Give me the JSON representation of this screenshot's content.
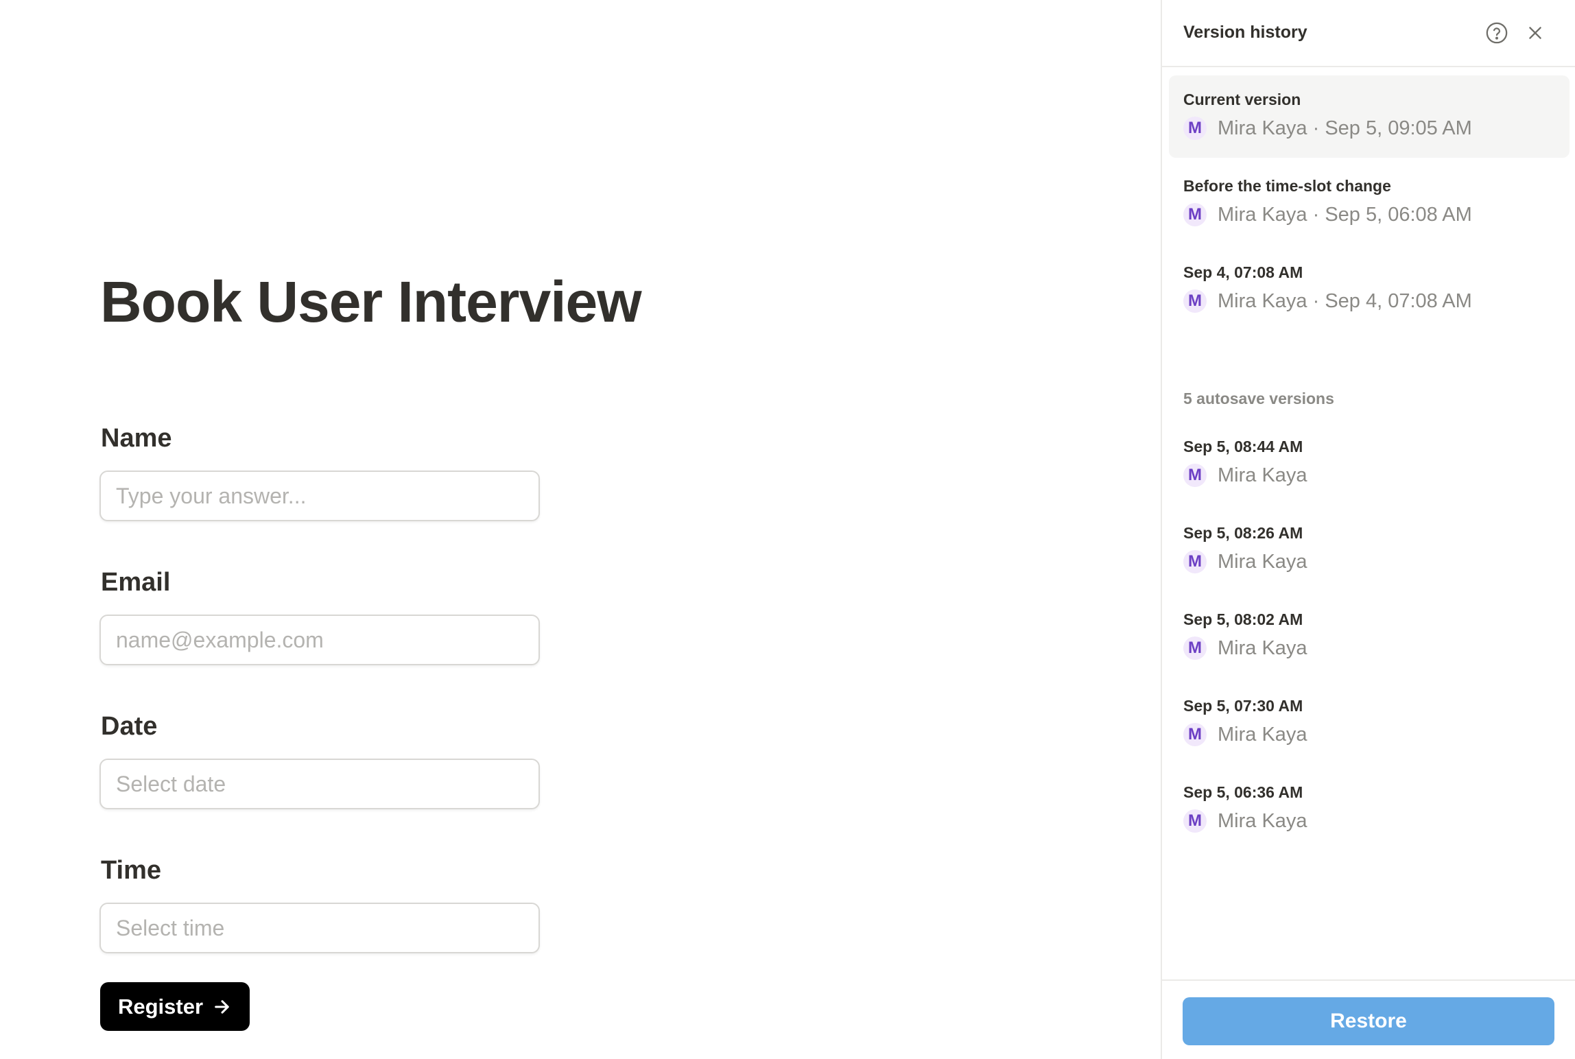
{
  "form": {
    "title": "Book User Interview",
    "fields": [
      {
        "label": "Name",
        "placeholder": "Type your answer..."
      },
      {
        "label": "Email",
        "placeholder": "name@example.com"
      },
      {
        "label": "Date",
        "placeholder": "Select date"
      },
      {
        "label": "Time",
        "placeholder": "Select time"
      }
    ],
    "submit_label": "Register"
  },
  "version_history": {
    "title": "Version history",
    "named_versions": [
      {
        "name": "Current version",
        "avatar": "M",
        "meta": "Mira Kaya · Sep 5, 09:05 AM",
        "selected": true
      },
      {
        "name": "Before the time-slot change",
        "avatar": "M",
        "meta": "Mira Kaya · Sep 5, 06:08 AM",
        "selected": false
      },
      {
        "name": "Sep 4, 07:08 AM",
        "avatar": "M",
        "meta": "Mira Kaya · Sep 4, 07:08 AM",
        "selected": false
      }
    ],
    "autosave_heading": "5 autosave versions",
    "autosave_versions": [
      {
        "name": "Sep 5, 08:44 AM",
        "avatar": "M",
        "meta": "Mira Kaya"
      },
      {
        "name": "Sep 5, 08:26 AM",
        "avatar": "M",
        "meta": "Mira Kaya"
      },
      {
        "name": "Sep 5, 08:02 AM",
        "avatar": "M",
        "meta": "Mira Kaya"
      },
      {
        "name": "Sep 5, 07:30 AM",
        "avatar": "M",
        "meta": "Mira Kaya"
      },
      {
        "name": "Sep 5, 06:36 AM",
        "avatar": "M",
        "meta": "Mira Kaya"
      }
    ],
    "restore_label": "Restore"
  },
  "icons": {
    "help": "help-circle-icon",
    "close": "close-icon",
    "submit_arrow": "arrow-right-icon"
  },
  "colors": {
    "avatar_bg": "#f1e8fb",
    "avatar_text": "#6c3fc4",
    "restore_button": "#65a9e5",
    "register_button": "#000000"
  }
}
